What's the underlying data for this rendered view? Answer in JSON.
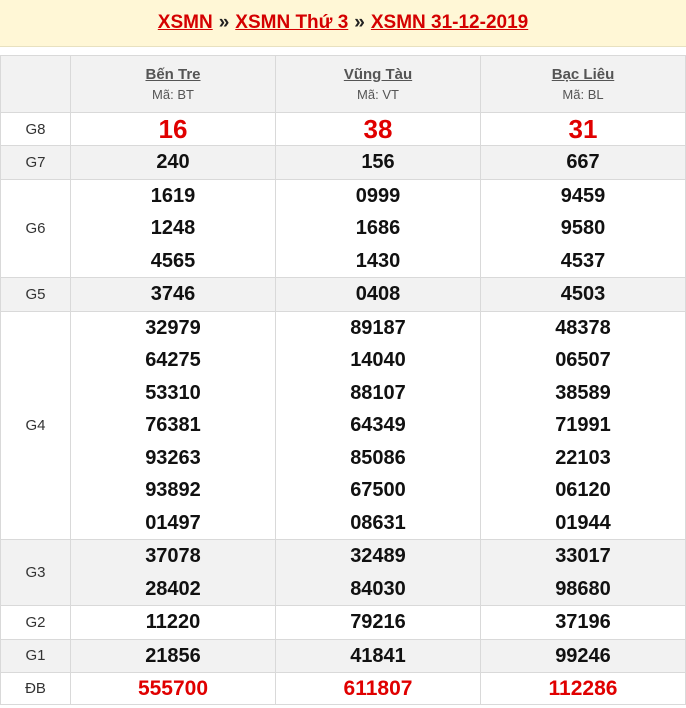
{
  "header": {
    "crumb1": "XSMN",
    "crumb2": "XSMN Thứ 3",
    "crumb3": "XSMN 31-12-2019",
    "separator": "»"
  },
  "provinces": [
    {
      "name": "Bến Tre",
      "code": "Mã: BT"
    },
    {
      "name": "Vũng Tàu",
      "code": "Mã: VT"
    },
    {
      "name": "Bạc Liêu",
      "code": "Mã: BL"
    }
  ],
  "prizes": [
    {
      "label": "G8",
      "values": [
        [
          "16"
        ],
        [
          "38"
        ],
        [
          "31"
        ]
      ]
    },
    {
      "label": "G7",
      "values": [
        [
          "240"
        ],
        [
          "156"
        ],
        [
          "667"
        ]
      ]
    },
    {
      "label": "G6",
      "values": [
        [
          "1619",
          "1248",
          "4565"
        ],
        [
          "0999",
          "1686",
          "1430"
        ],
        [
          "9459",
          "9580",
          "4537"
        ]
      ]
    },
    {
      "label": "G5",
      "values": [
        [
          "3746"
        ],
        [
          "0408"
        ],
        [
          "4503"
        ]
      ]
    },
    {
      "label": "G4",
      "values": [
        [
          "32979",
          "64275",
          "53310",
          "76381",
          "93263",
          "93892",
          "01497"
        ],
        [
          "89187",
          "14040",
          "88107",
          "64349",
          "85086",
          "67500",
          "08631"
        ],
        [
          "48378",
          "06507",
          "38589",
          "71991",
          "22103",
          "06120",
          "01944"
        ]
      ]
    },
    {
      "label": "G3",
      "values": [
        [
          "37078",
          "28402"
        ],
        [
          "32489",
          "84030"
        ],
        [
          "33017",
          "98680"
        ]
      ]
    },
    {
      "label": "G2",
      "values": [
        [
          "11220"
        ],
        [
          "79216"
        ],
        [
          "37196"
        ]
      ]
    },
    {
      "label": "G1",
      "values": [
        [
          "21856"
        ],
        [
          "41841"
        ],
        [
          "99246"
        ]
      ]
    },
    {
      "label": "ĐB",
      "values": [
        [
          "555700"
        ],
        [
          "611807"
        ],
        [
          "112286"
        ]
      ]
    }
  ],
  "colors": {
    "accent_red": "#e00000",
    "header_bg": "#fff7d6",
    "alt_row_bg": "#f2f2f2"
  }
}
